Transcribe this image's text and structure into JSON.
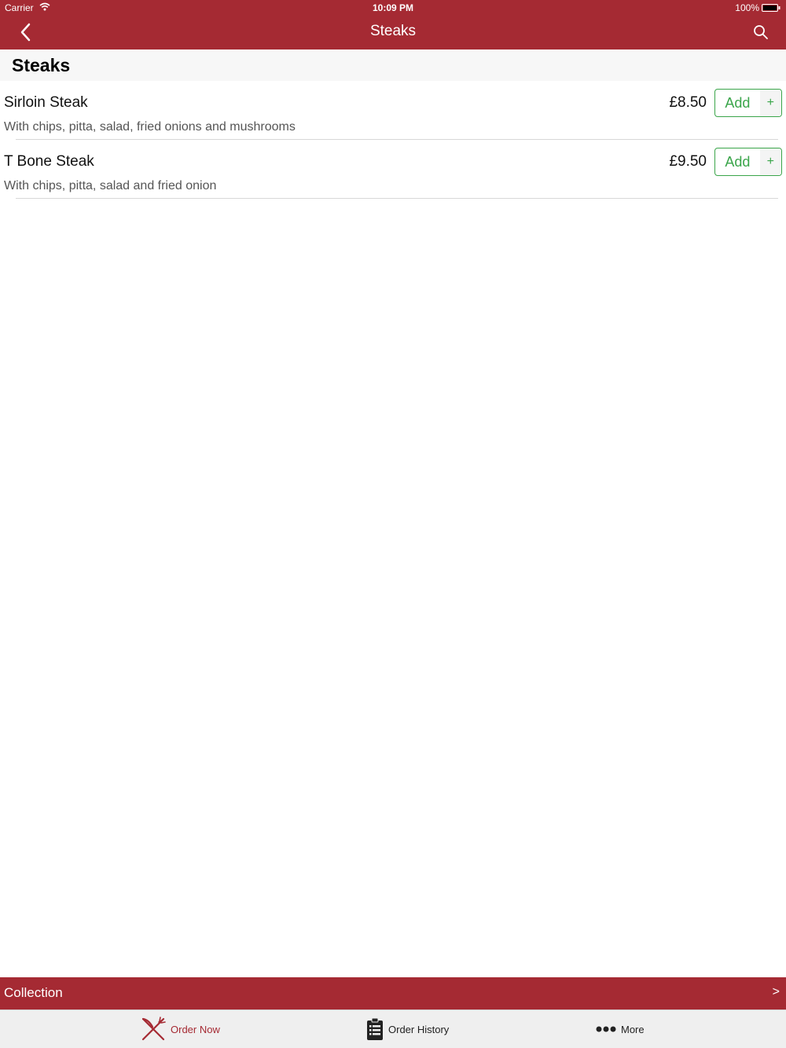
{
  "status_bar": {
    "carrier": "Carrier",
    "time": "10:09 PM",
    "battery": "100%"
  },
  "nav": {
    "title": "Steaks"
  },
  "section": {
    "title": "Steaks"
  },
  "items": [
    {
      "name": "Sirloin Steak",
      "description": "With chips, pitta, salad, fried onions and mushrooms",
      "price": "£8.50",
      "add_label": "Add",
      "add_plus": "+"
    },
    {
      "name": "T Bone Steak",
      "description": "With chips, pitta, salad and fried onion",
      "price": "£9.50",
      "add_label": "Add",
      "add_plus": "+"
    }
  ],
  "collection_bar": {
    "label": "Collection",
    "chevron": ">"
  },
  "tabs": [
    {
      "label": "Order Now",
      "icon": "fork-knife-icon",
      "active": true
    },
    {
      "label": "Order History",
      "icon": "clipboard-list-icon",
      "active": false
    },
    {
      "label": "More",
      "icon": "more-dots-icon",
      "active": false
    }
  ],
  "colors": {
    "brand": "#a52a33",
    "add_button": "#3aa54a",
    "section_bg": "#f7f7f7",
    "tab_bar_bg": "#efefef"
  }
}
